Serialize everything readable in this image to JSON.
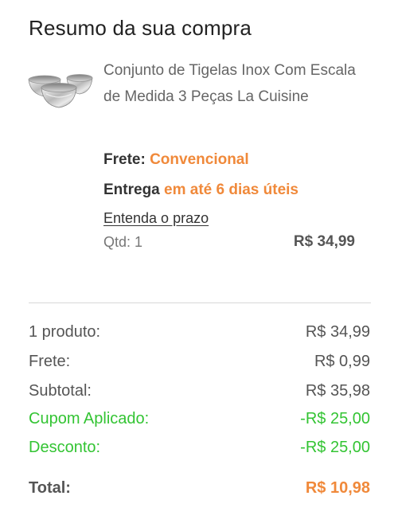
{
  "summary_title": "Resumo da sua compra",
  "product": {
    "name": "Conjunto de Tigelas Inox Com Escala de Medida 3 Peças La Cuisine",
    "image_icon": "steel-bowls-image",
    "shipping_label": "Frete:",
    "shipping_type": "Convencional",
    "delivery_label": "Entrega",
    "delivery_time": "em até 6 dias úteis",
    "deadline_link": "Entenda o prazo",
    "quantity": "Qtd: 1",
    "price": "R$ 34,99"
  },
  "totals": {
    "products_label": "1 produto:",
    "products_value": "R$ 34,99",
    "shipping_label": "Frete:",
    "shipping_value": "R$ 0,99",
    "subtotal_label": "Subtotal:",
    "subtotal_value": "R$ 35,98",
    "coupon_label": "Cupom Aplicado:",
    "coupon_value": "-R$ 25,00",
    "discount_label": "Desconto:",
    "discount_value": "-R$ 25,00",
    "total_label": "Total:",
    "total_value": "R$ 10,98"
  },
  "colors": {
    "accent_orange": "#f0893a",
    "discount_green": "#33c433",
    "divider": "#d8d8d8"
  }
}
